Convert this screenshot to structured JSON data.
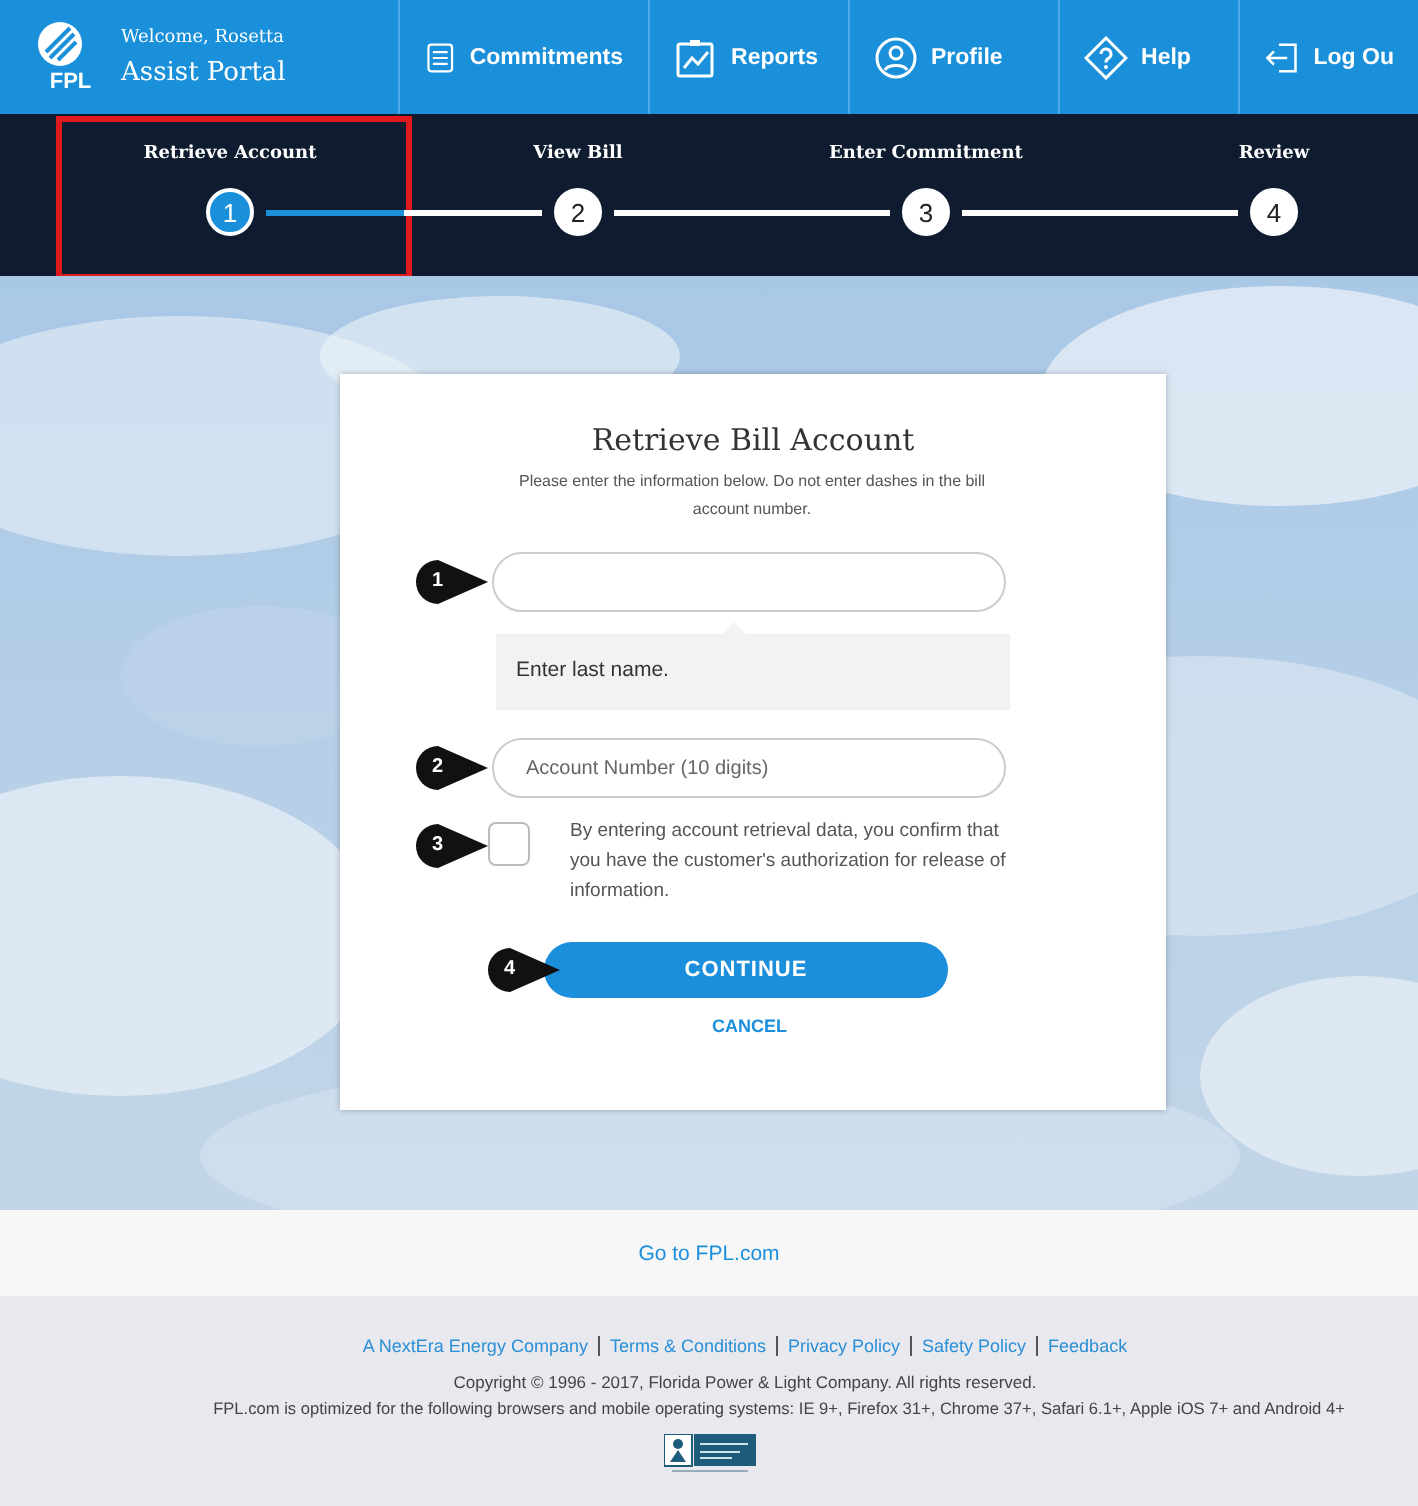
{
  "header": {
    "logo_text": "FPL",
    "welcome": "Welcome, Rosetta",
    "portal": "Assist Portal",
    "nav": [
      {
        "label": "Commitments"
      },
      {
        "label": "Reports"
      },
      {
        "label": "Profile"
      },
      {
        "label": "Help"
      },
      {
        "label": "Log Ou"
      }
    ]
  },
  "steps": [
    {
      "label": "Retrieve Account",
      "number": "1",
      "selected": true,
      "highlighted": true
    },
    {
      "label": "View Bill",
      "number": "2",
      "selected": false,
      "highlighted": false
    },
    {
      "label": "Enter Commitment",
      "number": "3",
      "selected": false,
      "highlighted": false
    },
    {
      "label": "Review",
      "number": "4",
      "selected": false,
      "highlighted": false
    }
  ],
  "form": {
    "title": "Retrieve Bill Account",
    "instructions": "Please enter the information below. Do not enter dashes in the bill account number.",
    "last_name": {
      "callout": "1",
      "tooltip": "Enter last name."
    },
    "account_number": {
      "callout": "2",
      "placeholder": "Account Number (10 digits)"
    },
    "consent": {
      "callout": "3",
      "checked": false,
      "text": "By entering account retrieval data, you confirm that you have the customer's authorization for release of information."
    },
    "continue": {
      "callout": "4",
      "label": "CONTINUE"
    },
    "cancel": "CANCEL"
  },
  "footer": {
    "go_link": "Go to FPL.com",
    "links": [
      "A NextEra Energy Company",
      "Terms & Conditions",
      "Privacy Policy",
      "Safety Policy",
      "Feedback"
    ],
    "copyright": "Copyright © 1996 - 2017, Florida Power & Light Company. All rights reserved.",
    "browsers": "FPL.com is optimized for the following browsers and mobile operating systems: IE 9+, Firefox 31+, Chrome 37+, Safari 6.1+, Apple iOS 7+ and Android 4+"
  }
}
